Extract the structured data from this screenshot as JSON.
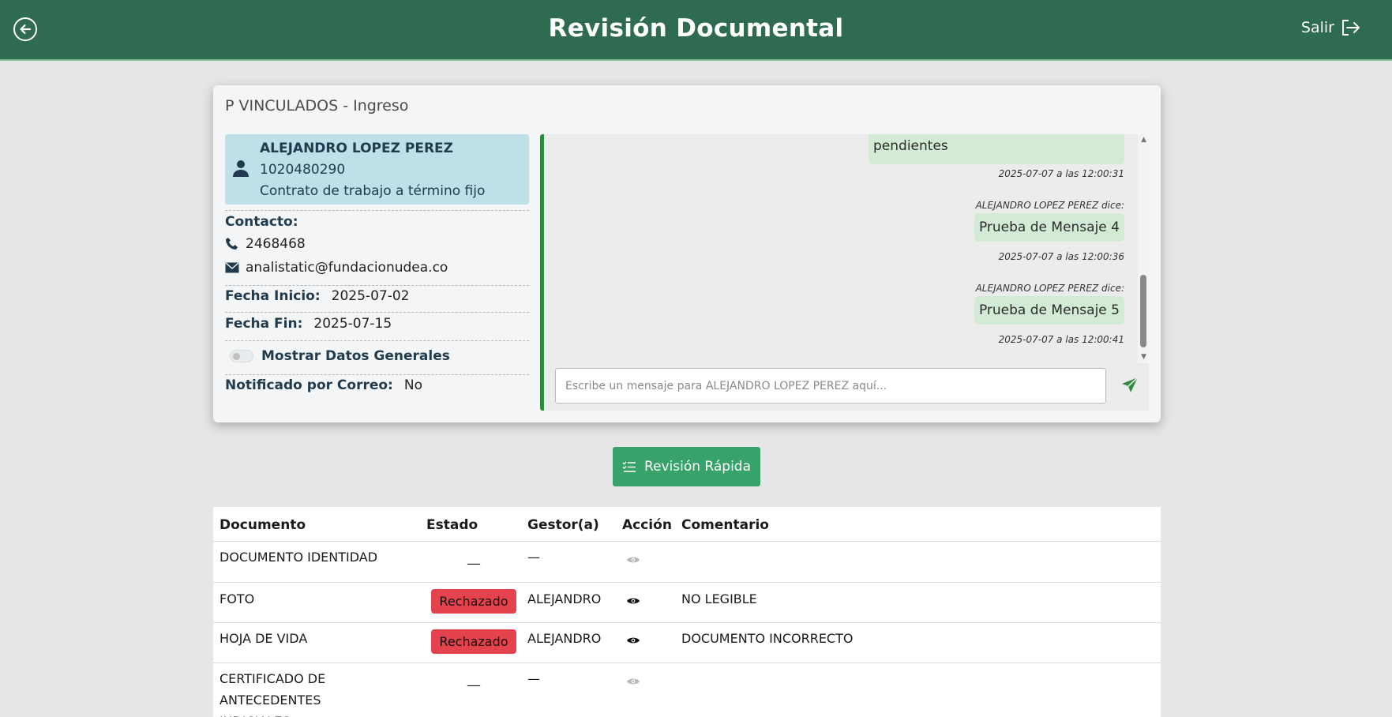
{
  "header": {
    "title": "Revisión Documental",
    "exit_label": "Salir",
    "bg_color": "#2e6b50"
  },
  "card": {
    "title": "P VINCULADOS - Ingreso",
    "person": {
      "name": "ALEJANDRO LOPEZ PEREZ",
      "id": "1020480290",
      "contract": "Contrato de trabajo a término fijo"
    },
    "contact_label": "Contacto:",
    "phone": "2468468",
    "email": "analistatic@fundacionudea.co",
    "start_label": "Fecha Inicio:",
    "start_value": "2025-07-02",
    "end_label": "Fecha Fin:",
    "end_value": "2025-07-15",
    "toggle_label": "Mostrar Datos Generales",
    "notified_label": "Notificado por Correo:",
    "notified_value": "No"
  },
  "chat": {
    "messages": [
      {
        "author": "",
        "text": "pendientes",
        "timestamp": "2025-07-07 a las 12:00:31"
      },
      {
        "author": "ALEJANDRO LOPEZ PEREZ dice:",
        "text": "Prueba de Mensaje 4",
        "timestamp": "2025-07-07 a las 12:00:36"
      },
      {
        "author": "ALEJANDRO LOPEZ PEREZ dice:",
        "text": "Prueba de Mensaje 5",
        "timestamp": "2025-07-07 a las 12:00:41"
      }
    ],
    "input_placeholder": "Escribe un mensaje para ALEJANDRO LOPEZ PEREZ aquí..."
  },
  "quick_review_label": "Revisión Rápida",
  "table": {
    "headers": [
      "Documento",
      "Estado",
      "Gestor(a)",
      "Acción",
      "Comentario"
    ],
    "rows": [
      {
        "document": "DOCUMENTO IDENTIDAD",
        "status": "__",
        "manager": "—",
        "comment": ""
      },
      {
        "document": "FOTO",
        "status": "Rechazado",
        "manager": "ALEJANDRO",
        "comment": "NO LEGIBLE"
      },
      {
        "document": "HOJA DE VIDA",
        "status": "Rechazado",
        "manager": "ALEJANDRO",
        "comment": "DOCUMENTO INCORRECTO"
      },
      {
        "document": "CERTIFICADO DE ANTECEDENTES JUDICIALES",
        "status": "__",
        "manager": "—",
        "comment": ""
      }
    ]
  },
  "colors": {
    "accent_green": "#37a36a",
    "rejected": "#e4424d",
    "person_bg": "#bde0e9",
    "bubble": "#d3ebd5"
  }
}
